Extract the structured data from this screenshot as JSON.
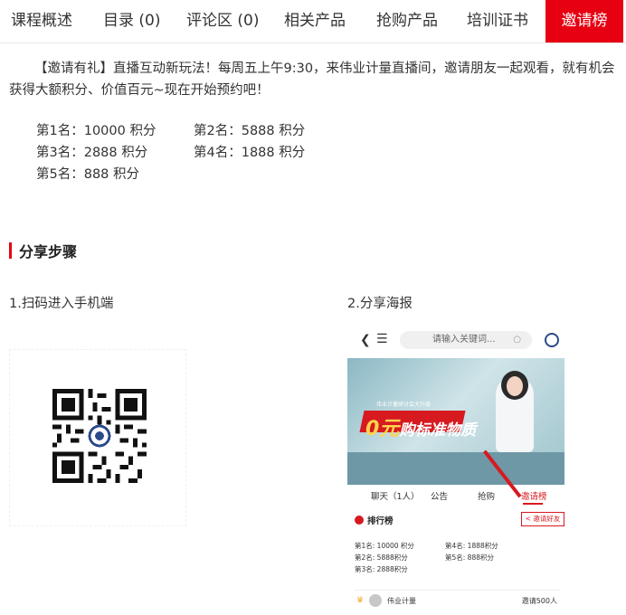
{
  "tabs": [
    {
      "label": "课程概述"
    },
    {
      "label": "目录 (0)"
    },
    {
      "label": "评论区 (0)"
    },
    {
      "label": "相关产品"
    },
    {
      "label": "抢购产品"
    },
    {
      "label": "培训证书"
    },
    {
      "label": "邀请榜",
      "active": true
    }
  ],
  "intro": "【邀请有礼】直播互动新玩法！每周五上午9:30，来伟业计量直播间，邀请朋友一起观看，就有机会获得大额积分、价值百元~现在开始预约吧！",
  "rankings": [
    "第1名：10000 积分",
    "第2名：5888 积分",
    "第3名：2888 积分",
    "第4名：1888 积分",
    "第5名：888 积分"
  ],
  "section_title": "分享步骤",
  "steps": {
    "step1": "1.扫码进入手机端",
    "step2": "2.分享海报"
  },
  "phone": {
    "back_icon": "chevron-left-icon",
    "menu_icon": "list-menu-icon",
    "search_placeholder": "请输入关键词...",
    "banner_small": "伟业计量研讨会大升级",
    "banner_big": "0元",
    "banner_text": "购标准物质",
    "tabs": [
      "聊天（1人）",
      "公告",
      "抢购",
      "邀请榜"
    ],
    "rank_title": "排行榜",
    "invite_button": "邀请好友",
    "rank_lines": [
      "第1名: 10000 积分",
      "第4名: 1888积分",
      "第2名: 5888积分",
      "第5名: 888积分",
      "第3名: 2888积分"
    ],
    "user_name": "伟业计量",
    "user_count": "邀请500人"
  },
  "colors": {
    "accent": "#e60012",
    "banner_red": "#d71920"
  }
}
